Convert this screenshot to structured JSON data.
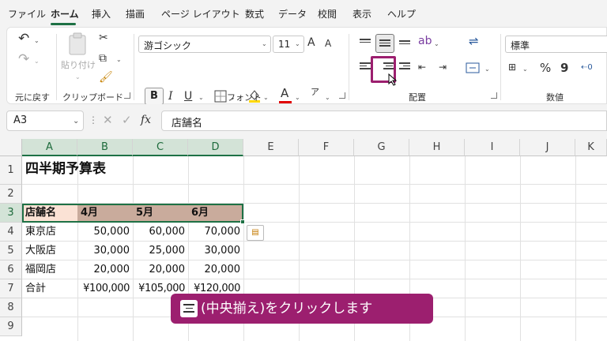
{
  "menu": {
    "items": [
      "ファイル",
      "ホーム",
      "挿入",
      "描画",
      "ページ レイアウト",
      "数式",
      "データ",
      "校閲",
      "表示",
      "ヘルプ"
    ],
    "active": "ホーム"
  },
  "ribbon": {
    "undo_group_label": "元に戻す",
    "clipboard": {
      "paste_label": "貼り付け",
      "group_label": "クリップボード"
    },
    "font": {
      "name": "游ゴシック",
      "size": "11",
      "grow": "A",
      "shrink": "A",
      "bold": "B",
      "italic": "I",
      "underline": "U",
      "group_label": "フォント",
      "fill_color": "#ffd800",
      "font_color": "#e00000"
    },
    "alignment": {
      "group_label": "配置",
      "highlight_color": "#9c1f6f"
    },
    "number": {
      "format": "標準",
      "percent": "%",
      "comma": "9",
      "group_label": "数値"
    }
  },
  "formula_bar": {
    "name_box": "A3",
    "fx": "fx",
    "value": "店舗名"
  },
  "grid": {
    "columns": [
      "A",
      "B",
      "C",
      "D",
      "E",
      "F",
      "G",
      "H",
      "I",
      "J",
      "K"
    ],
    "rows": [
      "1",
      "2",
      "3",
      "4",
      "5",
      "6",
      "7",
      "8",
      "9"
    ],
    "title": "四半期予算表",
    "header": [
      "店舗名",
      "4月",
      "5月",
      "6月"
    ],
    "data": [
      [
        "東京店",
        "50,000",
        "60,000",
        "70,000"
      ],
      [
        "大阪店",
        "30,000",
        "25,000",
        "30,000"
      ],
      [
        "福岡店",
        "20,000",
        "20,000",
        "20,000"
      ],
      [
        "合計",
        "¥100,000",
        "¥105,000",
        "¥120,000"
      ]
    ],
    "header_fill": "#c9ab9c",
    "header_first_fill": "#fbe2d5"
  },
  "caption": {
    "text": "(中央揃え)をクリックします",
    "bg": "#9c1f6f"
  }
}
